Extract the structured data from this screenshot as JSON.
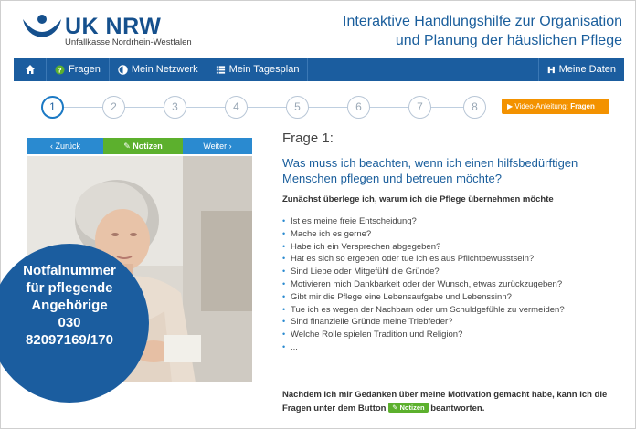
{
  "header": {
    "logo_name": "UK NRW",
    "logo_sub": "Unfallkasse Nordrhein-Westfalen",
    "title_line1": "Interaktive Handlungshilfe zur Organisation",
    "title_line2": "und Planung der häuslichen Pflege"
  },
  "nav": {
    "home_icon": "home-icon",
    "items": [
      {
        "label": "Fragen",
        "icon": "question-icon",
        "active": true
      },
      {
        "label": "Mein Netzwerk",
        "icon": "contrast-icon"
      },
      {
        "label": "Mein Tagesplan",
        "icon": "list-icon"
      }
    ],
    "right": {
      "label": "Meine Daten",
      "icon": "hospital-icon"
    }
  },
  "steps": {
    "items": [
      "1",
      "2",
      "3",
      "4",
      "5",
      "6",
      "7",
      "8"
    ],
    "current": 1,
    "video_prefix": "Video-Anleitung:",
    "video_topic": "Fragen"
  },
  "buttons": {
    "back": "‹ Zurück",
    "notes": "Notizen",
    "next": "Weiter ›"
  },
  "badge": {
    "line1": "Notfalnummer",
    "line2": "für pflegende",
    "line3": "Angehörige",
    "line4": "030",
    "line5": "82097169/170"
  },
  "question": {
    "number": "Frage 1:",
    "title": "Was muss ich beachten, wenn ich einen hilfsbedürftigen Menschen pflegen und betreuen möchte?",
    "subtitle": "Zunächst überlege ich, warum ich die Pflege übernehmen möchte",
    "items": [
      "Ist es meine freie Entscheidung?",
      "Mache ich es gerne?",
      "Habe ich ein Versprechen abgegeben?",
      "Hat es sich so ergeben oder tue ich es aus Pflichtbewusstsein?",
      "Sind Liebe oder Mitgefühl die Gründe?",
      "Motivieren mich Dankbarkeit oder der Wunsch, etwas zurückzugeben?",
      "Gibt mir die Pflege eine Lebensaufgabe und Lebenssinn?",
      "Tue ich es wegen der Nachbarn oder um Schuldgefühle zu vermeiden?",
      "Sind finanzielle Gründe meine Triebfeder?",
      "Welche Rolle spielen Tradition und Religion?",
      "..."
    ],
    "closing_before": "Nachdem ich mir Gedanken über meine Motivation gemacht habe, kann ich die Fragen unter dem Button",
    "closing_button": "Notizen",
    "closing_after": "beantworten."
  },
  "colors": {
    "brand_blue": "#1b5d9f",
    "button_blue": "#2a8ad0",
    "notes_green": "#5cb02d",
    "video_orange": "#f39200"
  }
}
